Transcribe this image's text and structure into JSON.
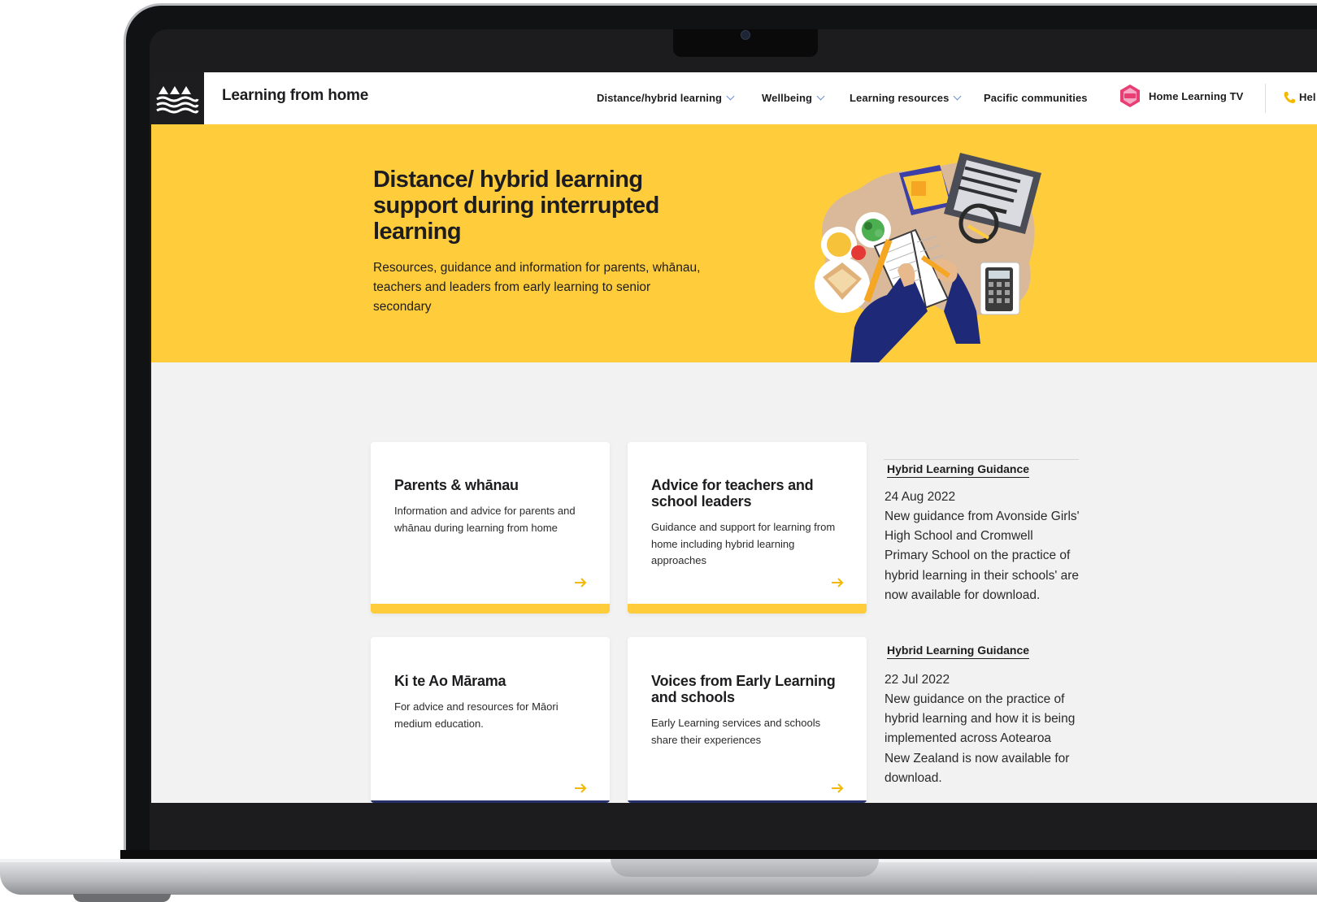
{
  "site": {
    "title": "Learning from home"
  },
  "nav": {
    "items": [
      {
        "label": "Distance/hybrid learning",
        "has_dropdown": true
      },
      {
        "label": "Wellbeing",
        "has_dropdown": true
      },
      {
        "label": "Learning resources",
        "has_dropdown": true
      },
      {
        "label": "Pacific communities",
        "has_dropdown": false
      }
    ],
    "tv_label": "Home Learning TV",
    "help_label": "Hel"
  },
  "hero": {
    "title": "Distance/ hybrid learning support during interrupted learning",
    "subtitle": "Resources, guidance and information for parents, whānau, teachers and leaders from early learning to senior secondary"
  },
  "cards": [
    {
      "title": "Parents & whānau",
      "desc": "Information and advice for parents and whānau during learning from home"
    },
    {
      "title": "Advice for teachers and school leaders",
      "desc": "Guidance and support for learning from home including hybrid learning approaches"
    },
    {
      "title": "Ki te Ao Mārama",
      "desc": "For advice and resources for Māori medium education."
    },
    {
      "title": "Voices from Early Learning and schools",
      "desc": "Early Learning services and schools share their experiences"
    }
  ],
  "news": [
    {
      "heading": "Hybrid Learning Guidance",
      "date": "24 Aug 2022",
      "body": "New guidance from Avonside Girls' High School and Cromwell Primary School on the practice of hybrid learning in their schools' are now available for download."
    },
    {
      "heading": "Hybrid Learning Guidance",
      "date": "22 Jul 2022",
      "body": "New guidance on the practice of hybrid learning and how it is being implemented across Aotearoa New Zealand is now available for download."
    }
  ],
  "colors": {
    "accent": "#ffcd3c",
    "navy": "#26306b",
    "text": "#1d1d1f",
    "background": "#f2f2f2"
  },
  "icons": [
    "mountains-waves-logo",
    "chevron-down-icon",
    "tv-badge-icon",
    "phone-icon",
    "arrow-right-icon"
  ]
}
